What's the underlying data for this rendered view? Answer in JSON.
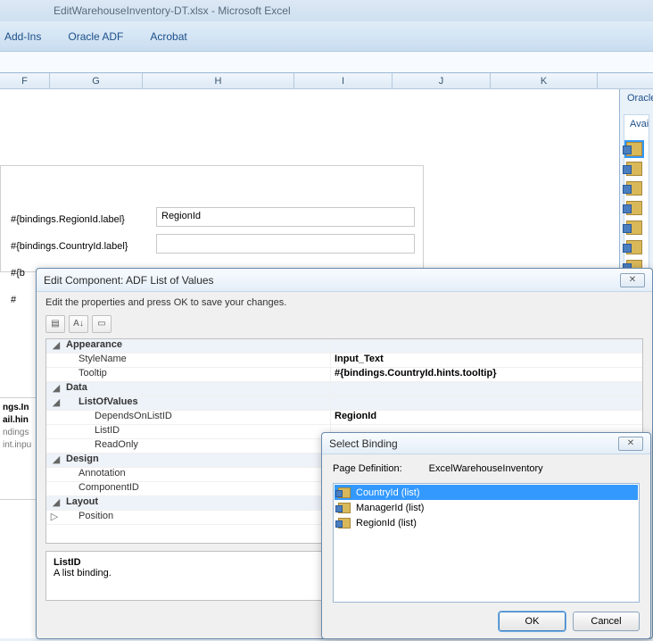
{
  "title_bar": "EditWarehouseInventory-DT.xlsx - Microsoft Excel",
  "ribbon_tabs": [
    "Add-Ins",
    "Oracle ADF",
    "Acrobat"
  ],
  "columns": [
    "F",
    "G",
    "H",
    "I",
    "J",
    "K"
  ],
  "side_panel_head": "Oracle",
  "side_panel_label": "Avai",
  "sheet": {
    "labels": [
      "#{bindings.RegionId.label}",
      "#{bindings.CountryId.label}",
      "#{b",
      "#"
    ],
    "input_value": "RegionId"
  },
  "snippet_lines": [
    "ngs.In",
    "ail.hin",
    "ndings",
    "int.inpu"
  ],
  "edit_dialog": {
    "title": "Edit Component: ADF List of Values",
    "message": "Edit the properties and press OK to save your changes.",
    "props": {
      "appearance": {
        "stylename": "Input_Text",
        "tooltip": "#{bindings.CountryId.hints.tooltip}"
      },
      "data_list_depends": "RegionId"
    },
    "prop_rows": [
      {
        "cat": true,
        "exp": "◢",
        "k": "Appearance",
        "v": ""
      },
      {
        "d": 1,
        "k": "StyleName",
        "v_key": "edit_dialog.props.appearance.stylename"
      },
      {
        "d": 1,
        "k": "Tooltip",
        "v_key": "edit_dialog.props.appearance.tooltip"
      },
      {
        "cat": true,
        "exp": "◢",
        "k": "Data",
        "v": ""
      },
      {
        "cat": true,
        "d": 1,
        "exp": "◢",
        "k": "ListOfValues",
        "v": ""
      },
      {
        "d": 2,
        "k": "DependsOnListID",
        "v_key": "edit_dialog.props.data_list_depends"
      },
      {
        "d": 2,
        "k": "ListID",
        "v": ""
      },
      {
        "d": 2,
        "k": "ReadOnly",
        "v": ""
      },
      {
        "cat": true,
        "exp": "◢",
        "k": "Design",
        "v": ""
      },
      {
        "d": 1,
        "k": "Annotation",
        "v": ""
      },
      {
        "d": 1,
        "k": "ComponentID",
        "v": ""
      },
      {
        "cat": true,
        "exp": "◢",
        "k": "Layout",
        "v": ""
      },
      {
        "d": 1,
        "exp": "▷",
        "k": "Position",
        "v": ""
      }
    ],
    "desc_title": "ListID",
    "desc_text": "A list binding."
  },
  "select_dialog": {
    "title": "Select Binding",
    "label": "Page Definition:",
    "value": "ExcelWarehouseInventory",
    "items": [
      {
        "label": "CountryId (list)",
        "sel": true
      },
      {
        "label": "ManagerId (list)",
        "sel": false
      },
      {
        "label": "RegionId (list)",
        "sel": false
      }
    ],
    "ok": "OK",
    "cancel": "Cancel"
  }
}
